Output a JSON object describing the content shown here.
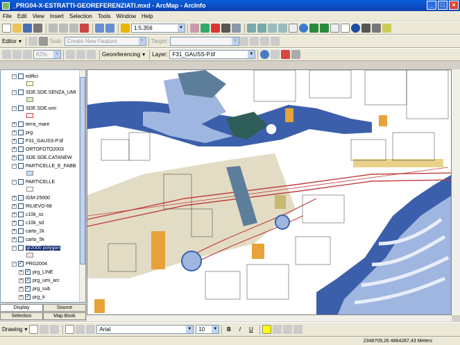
{
  "window": {
    "title": "_PRG04-X-ESTRATTI-GEOREFERENZIATI.mxd - ArcMap - ArcInfo"
  },
  "menu": [
    "File",
    "Edit",
    "View",
    "Insert",
    "Selection",
    "Tools",
    "Window",
    "Help"
  ],
  "standard_toolbar": {
    "scale": "1:5.356"
  },
  "editor_toolbar": {
    "editor_label": "Editor",
    "task_label": "Task:",
    "task_value": "Create New Feature",
    "target_label": "Target:",
    "target_value": ""
  },
  "georef_toolbar": {
    "zoom_value": "82%",
    "georef_label": "Georeferencing",
    "layer_label": "Layer:",
    "layer_value": "F31_GAUSS-P.tif"
  },
  "toc": {
    "layers": [
      {
        "name": "edifici",
        "checked": false,
        "expanded": true,
        "swatch": "#ffffbe"
      },
      {
        "name": "SDE.SDE.SENZA_UMI",
        "checked": false,
        "expanded": true,
        "swatch": "#d7f0b4"
      },
      {
        "name": "SDE.SDE.umi",
        "checked": false,
        "expanded": true,
        "swatch": "#ffffff",
        "swatch_border": "#e03c3c"
      },
      {
        "name": "terra_mare",
        "checked": false,
        "expanded": false
      },
      {
        "name": "prg",
        "checked": false,
        "expanded": false
      },
      {
        "name": "F31_GAUSS-P.tif",
        "checked": false,
        "expanded": false
      },
      {
        "name": "ORTOFOTO2003",
        "checked": false,
        "expanded": false
      },
      {
        "name": "SDE.SDE.CATANEW",
        "checked": false,
        "expanded": false
      },
      {
        "name": "PARTICELLE_E_FABB",
        "checked": false,
        "expanded": true,
        "swatch": "#bfe0ff"
      },
      {
        "name": "PARTICELLE",
        "checked": false,
        "expanded": true,
        "swatch": "#ffffff"
      },
      {
        "name": "IGM-25000",
        "checked": false,
        "expanded": false
      },
      {
        "name": "RILIEVO-68",
        "checked": false,
        "expanded": false
      },
      {
        "name": "c10k_ss",
        "checked": false,
        "expanded": false
      },
      {
        "name": "c10k_sd",
        "checked": false,
        "expanded": false
      },
      {
        "name": "carto_2k",
        "checked": false,
        "expanded": false
      },
      {
        "name": "carto_5k",
        "checked": false,
        "expanded": false
      },
      {
        "name": "gr2000 polygon",
        "checked": false,
        "expanded": true,
        "selected": true,
        "swatch": "#ffe6e6"
      },
      {
        "name": "PRG2004",
        "checked": true,
        "expanded": true,
        "group": true
      },
      {
        "name": "prg_LINE",
        "checked": true,
        "expanded": false,
        "indent": true
      },
      {
        "name": "prg_umi_arc",
        "checked": true,
        "expanded": false,
        "indent": true
      },
      {
        "name": "prg_sub",
        "checked": true,
        "expanded": false,
        "indent": true
      },
      {
        "name": "prg_ti",
        "checked": true,
        "expanded": false,
        "indent": true
      },
      {
        "name": "prg_zo",
        "checked": true,
        "expanded": false,
        "indent": true
      },
      {
        "name": "prg_du",
        "checked": true,
        "expanded": false,
        "indent": true
      },
      {
        "name": "prg_itu",
        "checked": true,
        "expanded": false,
        "indent": true
      }
    ],
    "tabs_top": [
      "Display",
      "Source"
    ],
    "tabs_bottom": [
      "Selection",
      "Map Book"
    ]
  },
  "drawing_toolbar": {
    "drawing_label": "Drawing",
    "font": "Arial",
    "font_size": "10",
    "bold": "B",
    "italic": "I",
    "underline": "U"
  },
  "status": {
    "coordinates": "2348709,26  4864287,43 Meters"
  },
  "colors": {
    "titlebar": "#0b4fd0",
    "water_dark": "#3b5faa",
    "water_light": "#9fb6e0",
    "building_orange": "#e8a23a",
    "building_slate": "#5d7e9a"
  }
}
